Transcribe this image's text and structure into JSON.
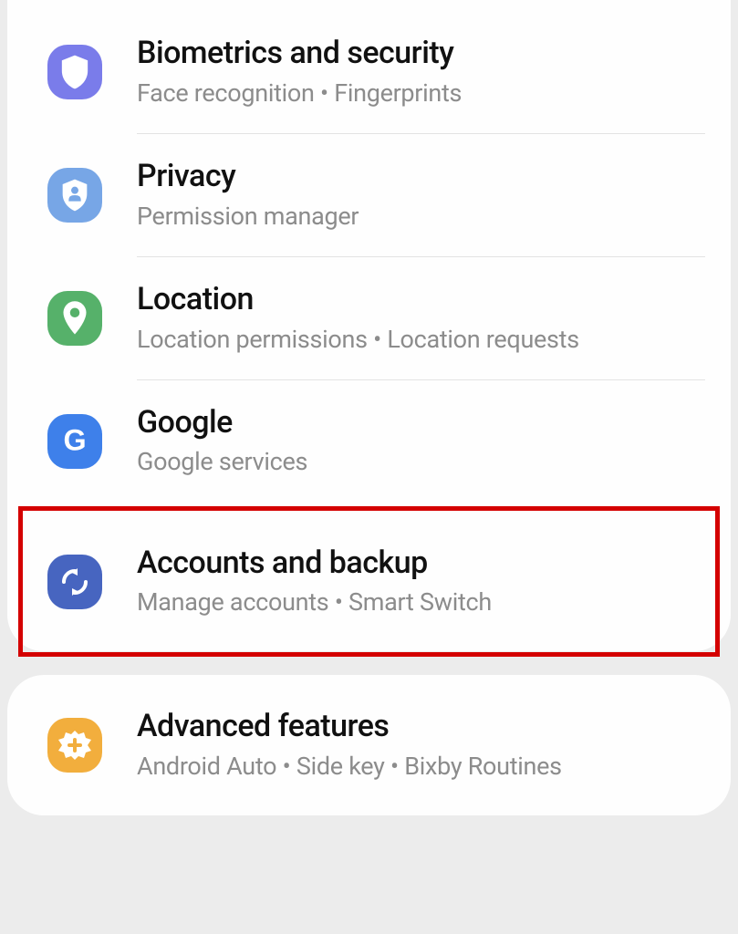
{
  "settings": {
    "group1": [
      {
        "id": "biometrics",
        "title": "Biometrics and security",
        "subtitle": "Face recognition  •  Fingerprints",
        "icon_bg": "#7a7cea",
        "icon": "shield"
      },
      {
        "id": "privacy",
        "title": "Privacy",
        "subtitle": "Permission manager",
        "icon_bg": "#77a6e6",
        "icon": "badge"
      },
      {
        "id": "location",
        "title": "Location",
        "subtitle": "Location permissions  •  Location requests",
        "icon_bg": "#56b16a",
        "icon": "pin"
      },
      {
        "id": "google",
        "title": "Google",
        "subtitle": "Google services",
        "icon_bg": "#3e80ea",
        "icon": "g"
      },
      {
        "id": "accounts-backup",
        "title": "Accounts and backup",
        "subtitle": "Manage accounts  •  Smart Switch",
        "icon_bg": "#4765c0",
        "icon": "sync",
        "highlighted": true
      }
    ],
    "group2": [
      {
        "id": "advanced-features",
        "title": "Advanced features",
        "subtitle": "Android Auto  •  Side key  •  Bixby Routines",
        "icon_bg": "#f2ae3d",
        "icon": "plus-badge"
      }
    ]
  }
}
